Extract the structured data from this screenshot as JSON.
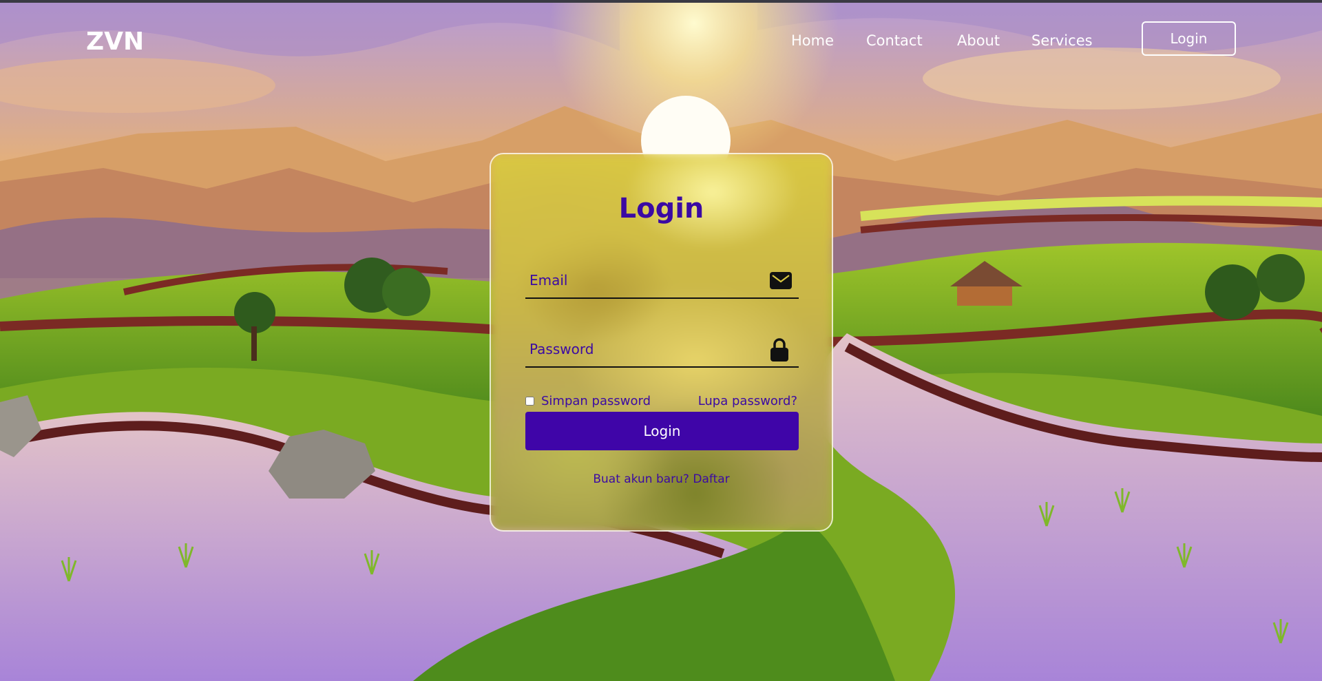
{
  "brand": {
    "logo": "ZVN"
  },
  "nav": {
    "links": [
      "Home",
      "Contact",
      "About",
      "Services"
    ],
    "login_button": "Login"
  },
  "login_form": {
    "title": "Login",
    "email_placeholder": "Email",
    "password_placeholder": "Password",
    "remember_label": "Simpan password",
    "remember_checked": false,
    "forgot_link": "Lupa password?",
    "submit_label": "Login",
    "register_prompt": "Buat akun baru?",
    "register_link": "Daftar"
  },
  "icons": {
    "email": "envelope-icon",
    "password": "lock-icon"
  },
  "colors": {
    "accent": "#3f05a8",
    "text_accent": "#3b0aa3",
    "nav_text": "#ffffff"
  }
}
